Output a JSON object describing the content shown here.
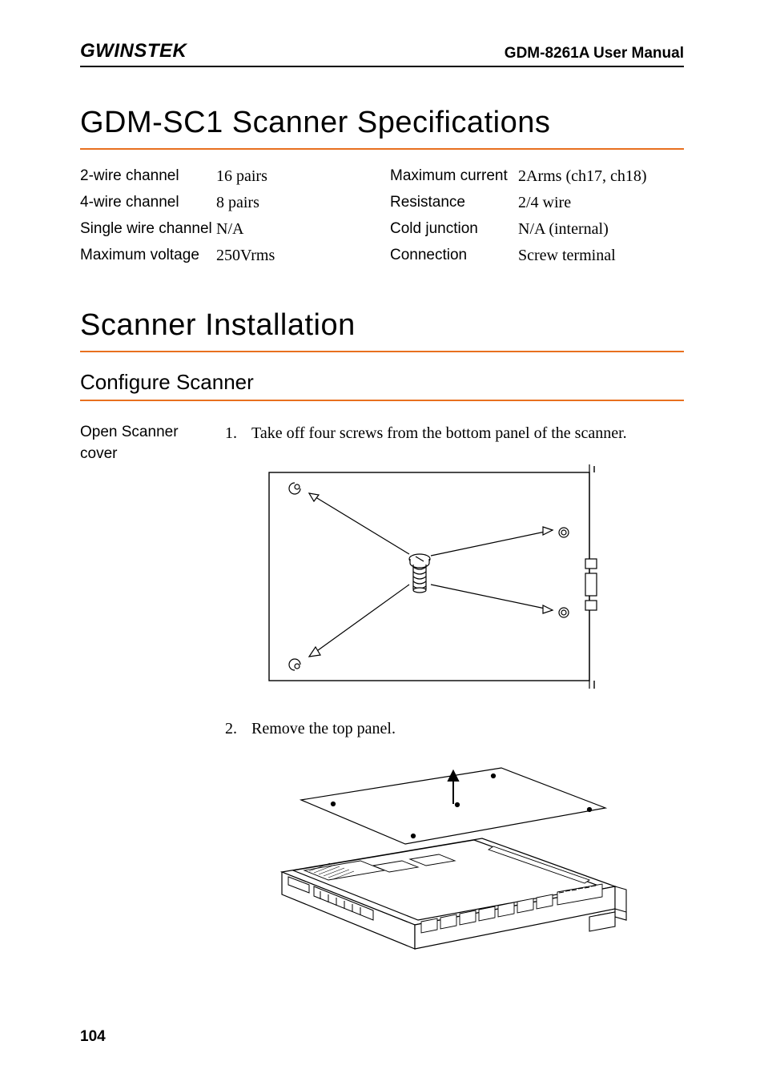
{
  "header": {
    "logo_text": "GWINSTEK",
    "manual_title": "GDM-8261A User Manual"
  },
  "section1": {
    "title": "GDM-SC1 Scanner Specifications",
    "specs_left": [
      {
        "label": "2-wire channel",
        "value": "16 pairs"
      },
      {
        "label": "4-wire channel",
        "value": "8 pairs"
      },
      {
        "label": "Single wire channel",
        "value": "N/A"
      },
      {
        "label": "Maximum voltage",
        "value": "250Vrms"
      }
    ],
    "specs_right": [
      {
        "label": "Maximum current",
        "value": "2Arms (ch17, ch18)"
      },
      {
        "label": "Resistance",
        "value": "2/4 wire"
      },
      {
        "label": "Cold junction",
        "value": "N/A (internal)"
      },
      {
        "label": "Connection",
        "value": "Screw terminal"
      }
    ]
  },
  "section2": {
    "title": "Scanner Installation",
    "subtitle": "Configure Scanner",
    "side_label": "Open Scanner cover",
    "steps": [
      {
        "num": "1.",
        "text": "Take off four screws from the bottom panel of the scanner."
      },
      {
        "num": "2.",
        "text": "Remove the top panel."
      }
    ]
  },
  "page_number": "104"
}
